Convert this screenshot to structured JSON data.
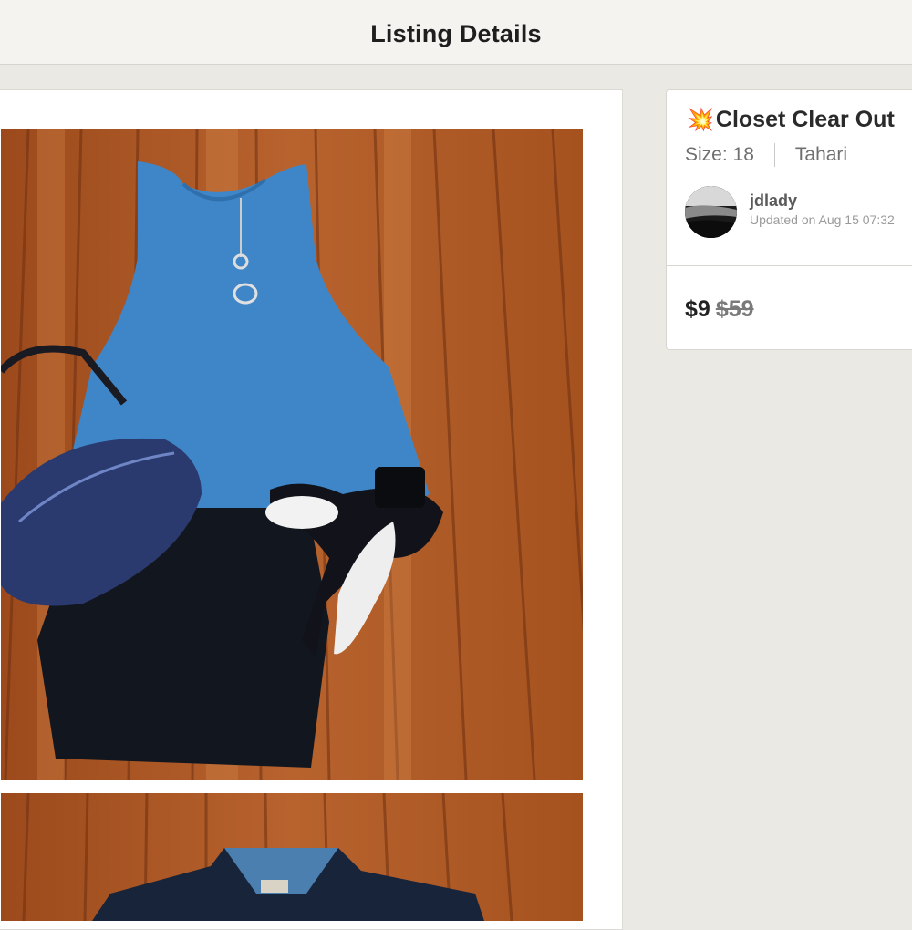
{
  "header": {
    "title": "Listing Details"
  },
  "listing": {
    "title_emoji": "💥",
    "title": "Closet Clear Out",
    "size_label": "Size: 18",
    "brand": "Tahari",
    "seller": {
      "username": "jdlady",
      "updated": "Updated on Aug 15 07:32"
    },
    "price": "$9",
    "original_price": "$59"
  },
  "icons": {
    "title_emoji": "collision-emoji",
    "avatar": "seller-avatar"
  },
  "colors": {
    "background": "#ebe9e4",
    "card": "#ffffff",
    "text": "#2d2d2d",
    "muted": "#6f6f6f"
  }
}
